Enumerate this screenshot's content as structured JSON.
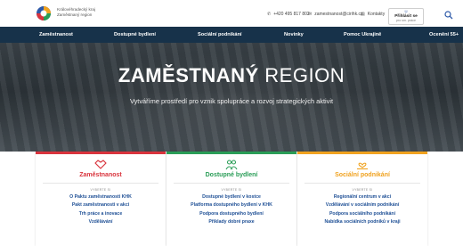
{
  "header": {
    "org_line1": "Královéhradecký kraj",
    "org_line2": "Zaměstnaný region",
    "phone": "+420 495 817 802",
    "email": "zamestnanost@cirihk.cz",
    "contacts": "Kontakty",
    "login_label": "Přihlásit se",
    "login_sub": "pro sm. práce",
    "phone_icon": "phone-icon",
    "email_icon": "envelope-icon",
    "contacts_icon": "card-icon",
    "search_icon": "search-icon"
  },
  "nav": {
    "items": [
      {
        "label": "Zaměstnanost"
      },
      {
        "label": "Dostupné bydlení"
      },
      {
        "label": "Sociální podnikání"
      },
      {
        "label": "Novinky"
      },
      {
        "label": "Pomoc Ukrajině"
      },
      {
        "label": "Ocenění 55+"
      }
    ]
  },
  "hero": {
    "title_bold": "ZAMĚSTNANÝ",
    "title_light": "REGION",
    "subtitle": "Vytváříme prostředí pro vznik spolupráce a rozvoj strategických aktivit"
  },
  "cards": [
    {
      "title": "Zaměstnanost",
      "label": "VYBERTE SI",
      "color": "#d9343d",
      "icon": "handshake-icon",
      "links": [
        "O Paktu zaměstnanosti KHK",
        "Pakt zaměstnanosti v akci",
        "Trh práce a inovace",
        "Vzdělávání"
      ]
    },
    {
      "title": "Dostupné bydlení",
      "label": "VYBERTE SI",
      "color": "#2a9d57",
      "icon": "people-icon",
      "links": [
        "Dostupné bydlení v kostce",
        "Platforma dostupného bydlení v KHK",
        "Podpora dostupného bydlení",
        "Příklady dobré praxe"
      ]
    },
    {
      "title": "Sociální podnikání",
      "label": "VYBERTE SI",
      "color": "#f0a21f",
      "icon": "heart-hand-icon",
      "links": [
        "Regionální centrum v akci",
        "Vzdělávání v sociálním podnikání",
        "Podpora sociálního podnikání",
        "Nabídka sociálních podniků v kraji"
      ]
    }
  ]
}
